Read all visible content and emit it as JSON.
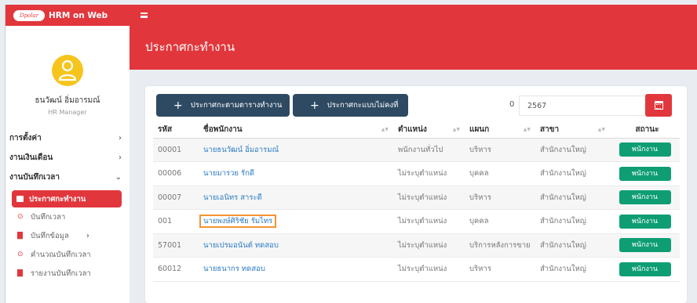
{
  "app": {
    "brand_logo_text": "Dpolar",
    "name": "HRM on Web"
  },
  "user": {
    "name": "ธนวัฒน์ อิ่มอารมณ์",
    "role": "HR Manager"
  },
  "sidebar": {
    "menu": [
      {
        "label": "การตั้งค่า",
        "chevron": "›"
      },
      {
        "label": "งานเงินเดือน",
        "chevron": "›"
      },
      {
        "label": "งานบันทึกเวลา",
        "chevron": "⌄"
      }
    ],
    "active_sub": "ประกาศกะทำงาน",
    "sub_items": [
      {
        "label": "บันทึกเวลา",
        "icon": "clock-icon",
        "chevron": ""
      },
      {
        "label": "บันทึกข้อมูล",
        "icon": "file-icon",
        "chevron": "›"
      },
      {
        "label": "คำนวณบันทึกเวลา",
        "icon": "clock-icon",
        "chevron": ""
      },
      {
        "label": "รายงานบันทึกเวลา",
        "icon": "file-icon",
        "chevron": ""
      }
    ]
  },
  "page": {
    "title": "ประกาศกะทำงาน"
  },
  "toolbar": {
    "btn_schedule": "ประกาศกะตามตารางทำงาน",
    "btn_flexible": "ประกาศกะแบบไม่คงที่",
    "count": "0",
    "year_value": "2567"
  },
  "table": {
    "headers": {
      "code": "รหัส",
      "name": "ชื่อพนักงาน",
      "position": "ตำแหน่ง",
      "department": "แผนก",
      "branch": "สาขา",
      "status": "สถานะ"
    },
    "rows": [
      {
        "code": "00001",
        "name": "นายธนวัฒน์ อิ่มอารมณ์",
        "position": "พนักงานทั่วไป",
        "department": "บริหาร",
        "branch": "สำนักงานใหญ่",
        "status": "พนักงาน"
      },
      {
        "code": "00006",
        "name": "นายมารวย รักดี",
        "position": "ไม่ระบุตำแหน่ง",
        "department": "บุคคล",
        "branch": "สำนักงานใหญ่",
        "status": "พนักงาน"
      },
      {
        "code": "00007",
        "name": "นายเอนิทร สาระดี",
        "position": "ไม่ระบุตำแหน่ง",
        "department": "บริหาร",
        "branch": "สำนักงานใหญ่",
        "status": "พนักงาน"
      },
      {
        "code": "001",
        "name": "นายพงษ์ศิริชัย รัมไทร",
        "position": "ไม่ระบุตำแหน่ง",
        "department": "บุคคล",
        "branch": "สำนักงานใหญ่",
        "status": "พนักงาน"
      },
      {
        "code": "57001",
        "name": "นายเปรมอนันต์ ทดสอบ",
        "position": "ไม่ระบุตำแหน่ง",
        "department": "บริการหลังการขาย",
        "branch": "สำนักงานใหญ่",
        "status": "พนักงาน"
      },
      {
        "code": "60012",
        "name": "นายธนากร ทดสอบ",
        "position": "ไม่ระบุตำแหน่ง",
        "department": "บริหาร",
        "branch": "สำนักงานใหญ่",
        "status": "พนักงาน"
      }
    ]
  },
  "colors": {
    "primary_red": "#e1373c",
    "navy": "#2e4a62",
    "status_green": "#0f9e74",
    "highlight_orange": "#f59333"
  }
}
